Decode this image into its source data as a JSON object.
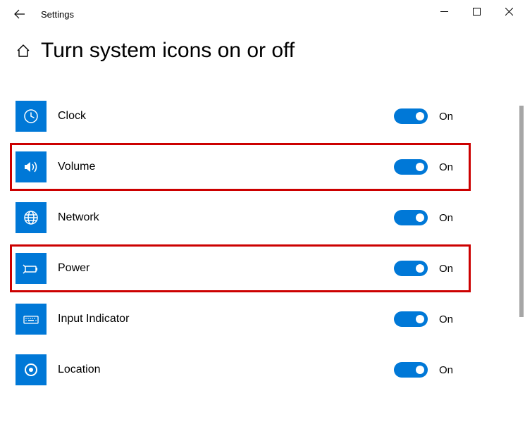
{
  "window": {
    "title": "Settings"
  },
  "page": {
    "title": "Turn system icons on or off"
  },
  "items": [
    {
      "icon": "clock-icon",
      "label": "Clock",
      "state": "On",
      "highlighted": false
    },
    {
      "icon": "volume-icon",
      "label": "Volume",
      "state": "On",
      "highlighted": true
    },
    {
      "icon": "network-icon",
      "label": "Network",
      "state": "On",
      "highlighted": false
    },
    {
      "icon": "power-icon",
      "label": "Power",
      "state": "On",
      "highlighted": true
    },
    {
      "icon": "input-indicator-icon",
      "label": "Input Indicator",
      "state": "On",
      "highlighted": false
    },
    {
      "icon": "location-icon",
      "label": "Location",
      "state": "On",
      "highlighted": false
    }
  ],
  "colors": {
    "accent": "#0078d7",
    "highlight": "#cc0000"
  }
}
